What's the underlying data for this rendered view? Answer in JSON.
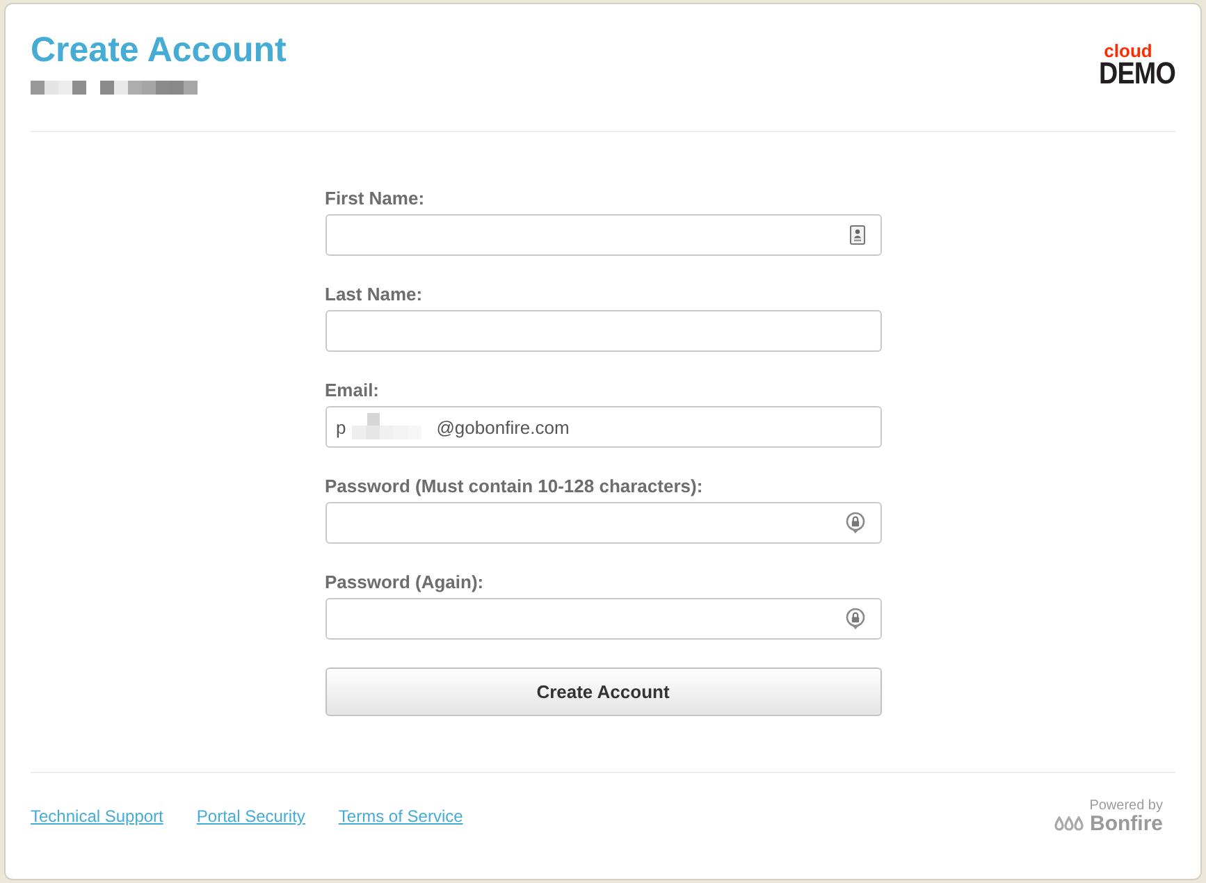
{
  "header": {
    "title": "Create Account",
    "subtitle_redacted": true
  },
  "logo": {
    "tagline": "cloud",
    "wordmark": "DEMO"
  },
  "form": {
    "fields": [
      {
        "label": "First Name:",
        "kind": "contact"
      },
      {
        "label": "Last Name:",
        "kind": "plain"
      },
      {
        "label": "Email:",
        "kind": "email",
        "value": "p",
        "redacted": true,
        "value_end": "@gobonfire.com"
      },
      {
        "label": "Password (Must contain 10-128 characters):",
        "kind": "password"
      },
      {
        "label": "Password (Again):",
        "kind": "password"
      }
    ],
    "submit": "Create Account"
  },
  "footer": {
    "links": [
      "Technical Support",
      "Portal Security",
      "Terms of Service"
    ],
    "powered_by": "Powered by",
    "brand": "Bonfire"
  }
}
